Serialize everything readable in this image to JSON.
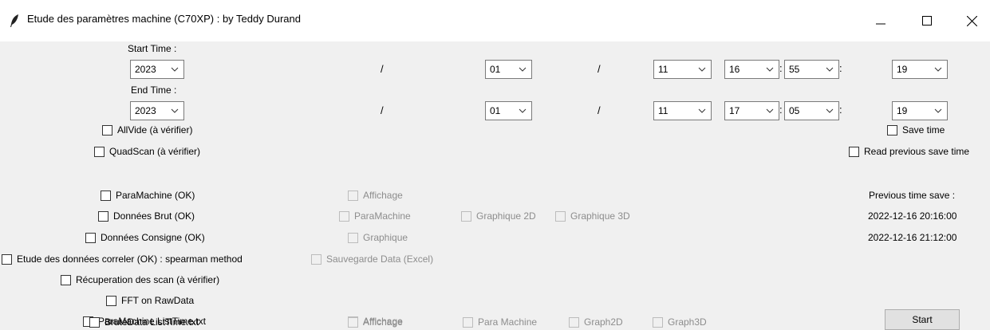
{
  "window": {
    "title": "Etude des paramètres machine (C70XP) : by Teddy Durand",
    "icon": "feather-icon",
    "controls": [
      "minimize-icon",
      "maximize-icon",
      "close-icon"
    ]
  },
  "start_time": {
    "label": "Start Time :",
    "year": "2023",
    "month": "01",
    "day": "11",
    "hour": "16",
    "minute": "55",
    "second": "19"
  },
  "end_time": {
    "label": "End Time :",
    "year": "2023",
    "month": "01",
    "day": "11",
    "hour": "17",
    "minute": "05",
    "second": "19"
  },
  "separators": {
    "slash": "/",
    "colon": ":"
  },
  "options": {
    "allvide": "AllVide (à vérifier)",
    "quadscan": "QuadScan (à vérifier)",
    "paramachine": "ParaMachine (OK)",
    "donnees_brut": "Données Brut (OK)",
    "donnees_consigne": "Données Consigne (OK)",
    "etude_correler": "Etude des données correler (OK) : spearman method",
    "recuperation_scan": "Récuperation des scan (à vérifier)",
    "fft_rawdata": "FFT on RawData",
    "paramachine_listtime": "ParaMachine ListTime.txt",
    "brutedata_listtime": "BruteData ListTime.txt"
  },
  "sub_options": {
    "paramachine_affichage": "Affichage",
    "brut_paramachine": "ParaMachine",
    "brut_graphique2d": "Graphique 2D",
    "brut_graphique3d": "Graphique 3D",
    "consigne_graphique": "Graphique",
    "correler_sauvegarde": "Sauvegarde Data (Excel)",
    "listtime_affichage": "Affichage",
    "brute_affichage": "Affichage",
    "brute_para_machine": "Para Machine",
    "brute_graph2d": "Graph2D",
    "brute_graph3d": "Graph3D"
  },
  "right_panel": {
    "save_time": "Save time",
    "read_previous": "Read previous save time",
    "previous_label": "Previous time save :",
    "previous_start": "2022-12-16 20:16:00",
    "previous_end": "2022-12-16 21:12:00"
  },
  "start_button": "Start"
}
